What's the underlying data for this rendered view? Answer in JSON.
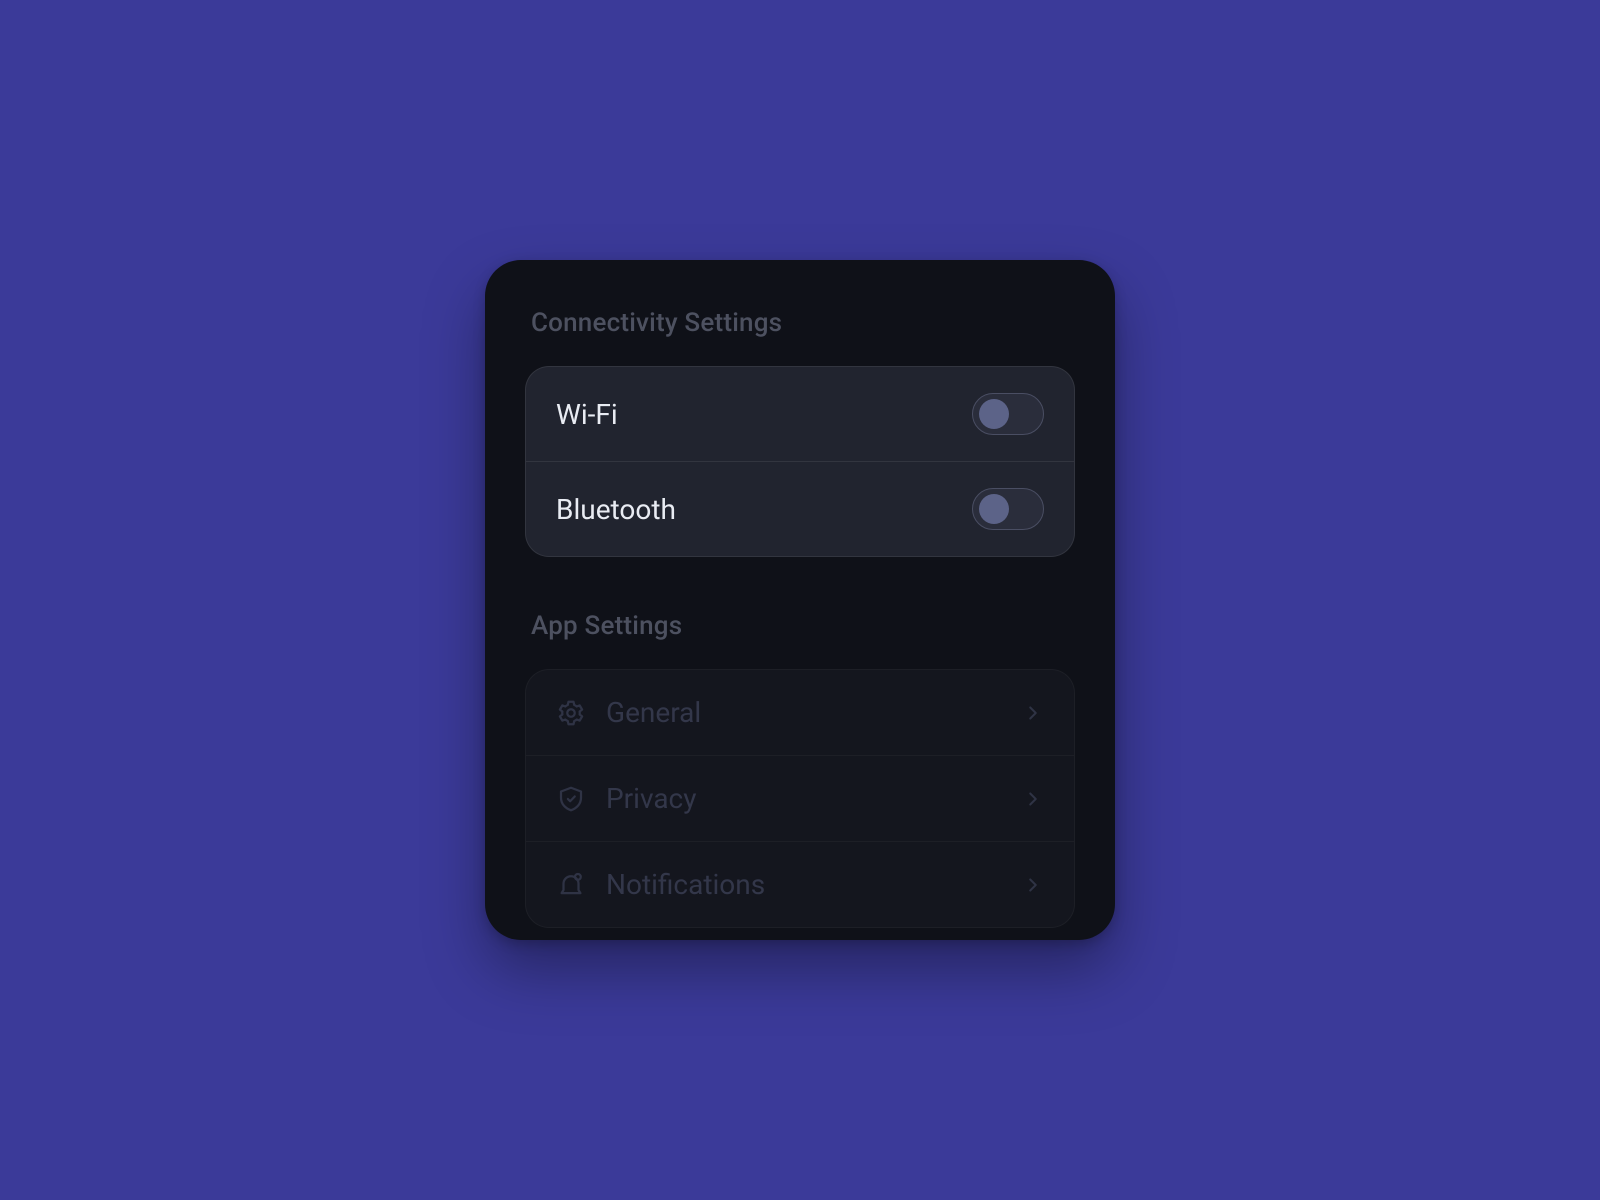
{
  "sections": {
    "connectivity": {
      "title": "Connectivity Settings",
      "items": [
        {
          "label": "Wi-Fi",
          "on": false
        },
        {
          "label": "Bluetooth",
          "on": false
        }
      ]
    },
    "app": {
      "title": "App Settings",
      "items": [
        {
          "label": "General"
        },
        {
          "label": "Privacy"
        },
        {
          "label": "Notifications"
        }
      ]
    }
  }
}
